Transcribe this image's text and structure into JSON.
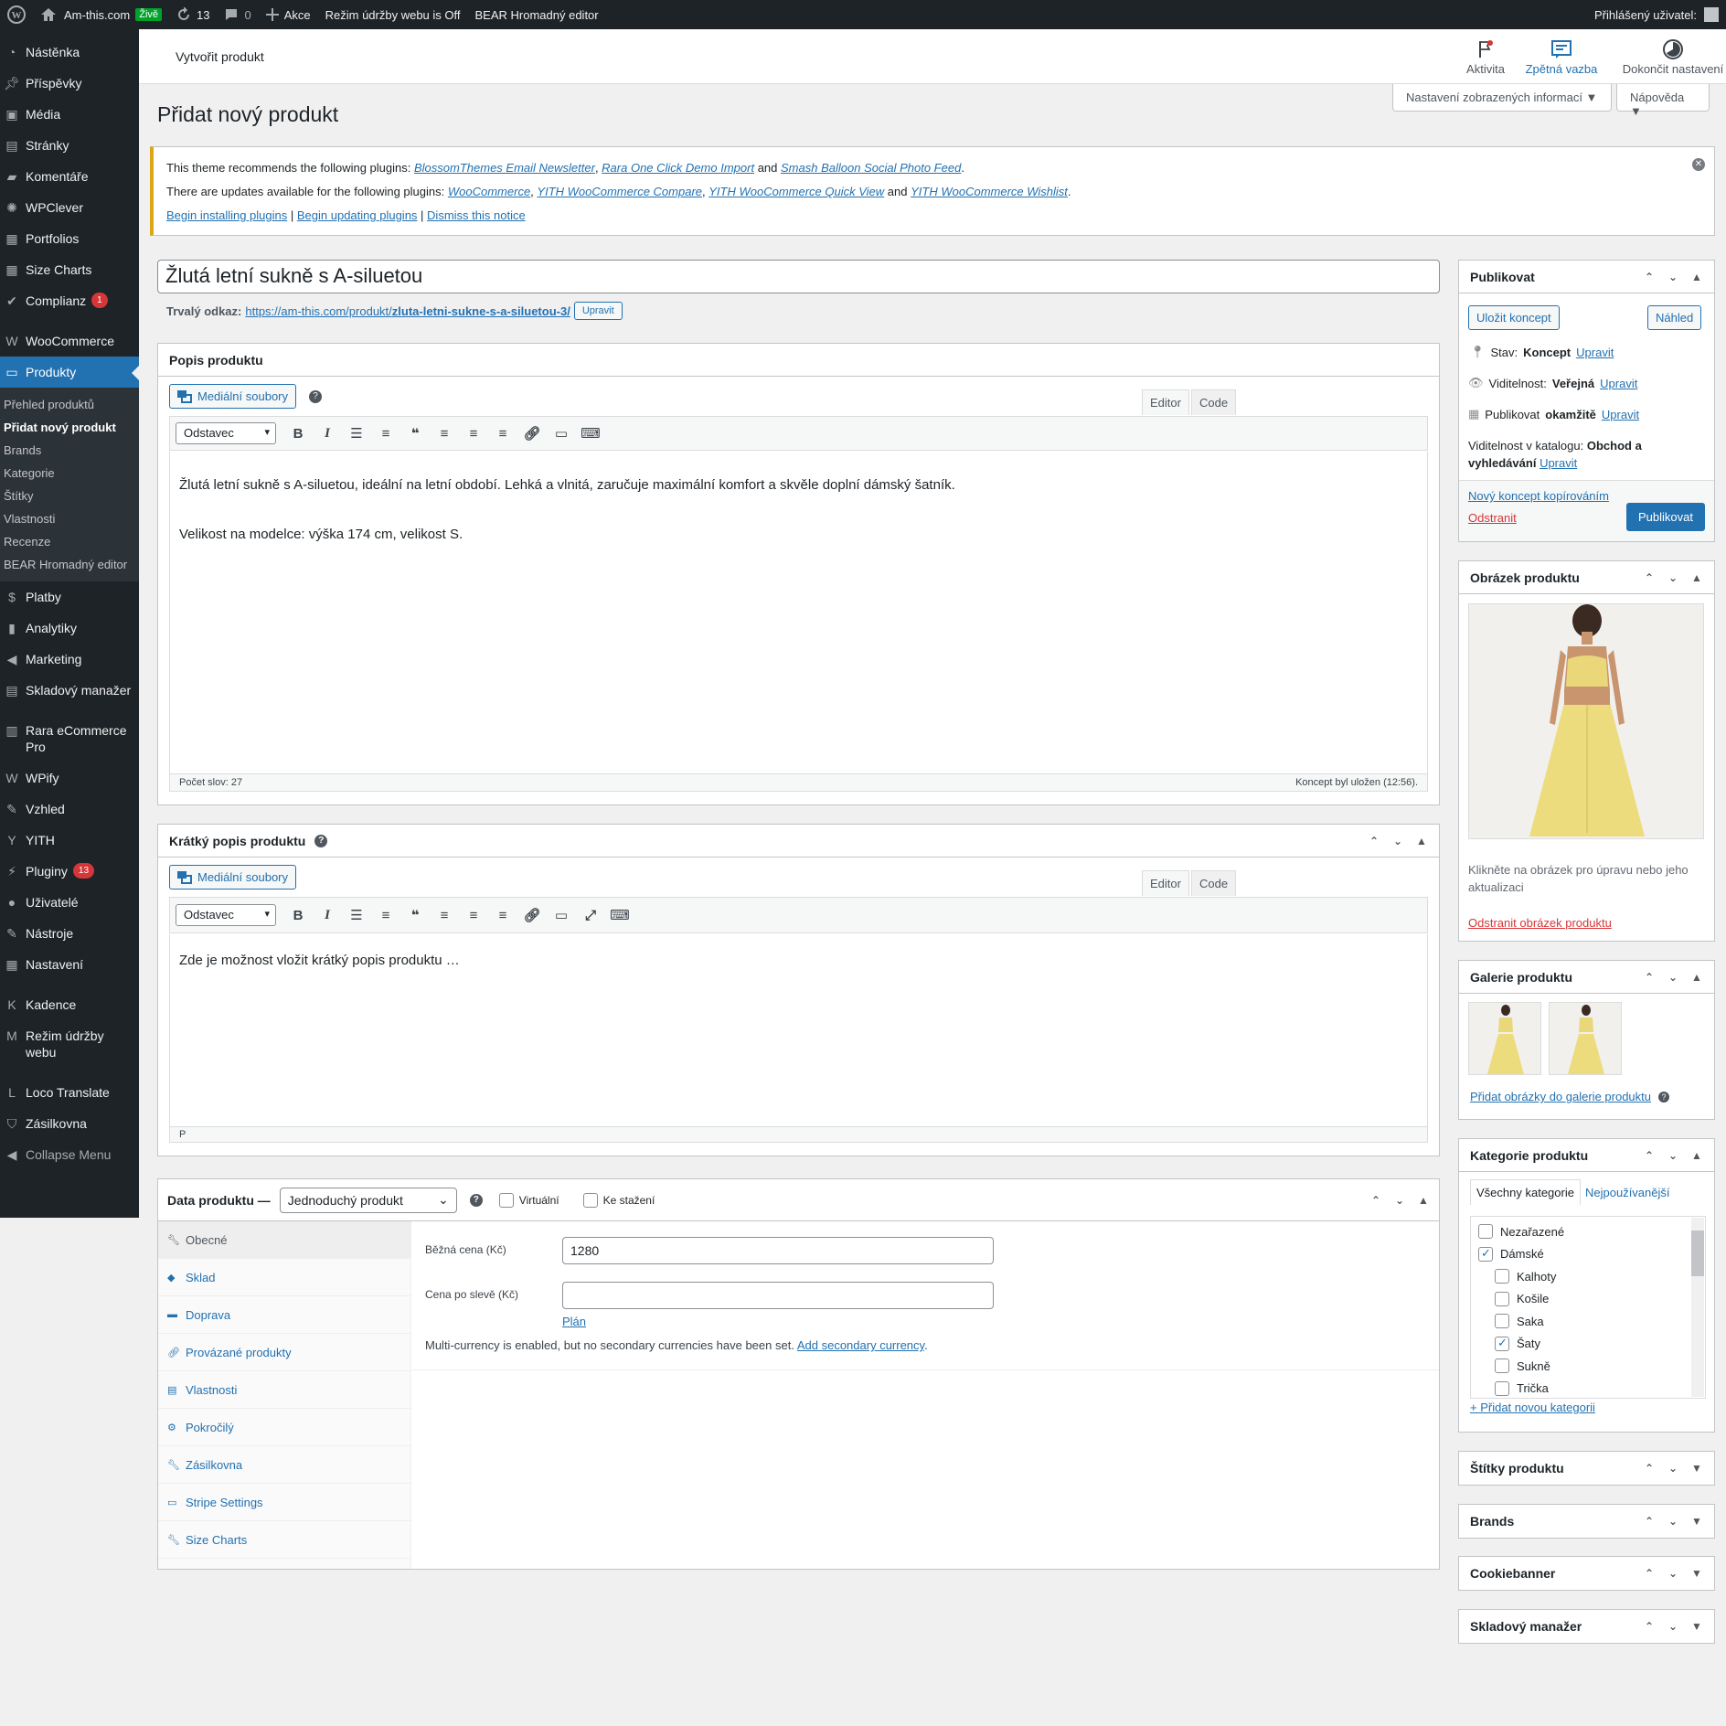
{
  "adminbar": {
    "site_name": "Am-this.com",
    "live_badge": "Živě",
    "updates_count": "13",
    "comments_count": "0",
    "new_label": "Akce",
    "maintenance": "Režim údržby webu is Off",
    "bear": "BEAR Hromadný editor",
    "user_label": "Přihlášený uživatel:"
  },
  "sidebar": {
    "items_top": [
      {
        "label": "Nástěnka",
        "icon": "dashboard-icon"
      },
      {
        "label": "Příspěvky",
        "icon": "pin-icon"
      },
      {
        "label": "Média",
        "icon": "media-icon"
      },
      {
        "label": "Stránky",
        "icon": "pages-icon"
      },
      {
        "label": "Komentáře",
        "icon": "comments-icon"
      },
      {
        "label": "WPClever",
        "icon": "bulb-icon"
      },
      {
        "label": "Portfolios",
        "icon": "portfolio-icon"
      },
      {
        "label": "Size Charts",
        "icon": "table-icon"
      },
      {
        "label": "Complianz",
        "icon": "check-icon",
        "count": "1"
      },
      {
        "label": "WooCommerce",
        "icon": "woo-icon"
      },
      {
        "label": "Produkty",
        "icon": "archive-icon"
      }
    ],
    "submenu": [
      "Přehled produktů",
      "Přidat nový produkt",
      "Brands",
      "Kategorie",
      "Štítky",
      "Vlastnosti",
      "Recenze",
      "BEAR Hromadný editor"
    ],
    "items_bottom": [
      {
        "label": "Platby",
        "icon": "payments-icon"
      },
      {
        "label": "Analytiky",
        "icon": "chart-icon"
      },
      {
        "label": "Marketing",
        "icon": "megaphone-icon"
      },
      {
        "label": "Skladový manažer",
        "icon": "stock-icon"
      },
      {
        "label": "Rara eCommerce Pro",
        "icon": "stats-icon"
      },
      {
        "label": "WPify",
        "icon": "wpify-icon"
      },
      {
        "label": "Vzhled",
        "icon": "brush-icon"
      },
      {
        "label": "YITH",
        "icon": "yith-icon"
      },
      {
        "label": "Pluginy",
        "icon": "plugin-icon",
        "count": "13"
      },
      {
        "label": "Uživatelé",
        "icon": "users-icon"
      },
      {
        "label": "Nástroje",
        "icon": "tools-icon"
      },
      {
        "label": "Nastavení",
        "icon": "settings-icon"
      },
      {
        "label": "Kadence",
        "icon": "kadence-icon"
      },
      {
        "label": "Režim údržby webu",
        "icon": "maintenance-icon"
      },
      {
        "label": "Loco Translate",
        "icon": "translate-icon"
      },
      {
        "label": "Zásilkovna",
        "icon": "shield-icon"
      },
      {
        "label": "Collapse Menu",
        "icon": "collapse-icon"
      }
    ]
  },
  "topbar": {
    "title": "Vytvořit produkt",
    "activity": "Aktivita",
    "feedback": "Zpětná vazba",
    "finish": "Dokončit nastavení",
    "screen_options": "Nastavení zobrazených informací",
    "help": "Nápověda"
  },
  "page_title": "Přidat nový produkt",
  "notice": {
    "line1_prefix": "This theme recommends the following plugins:",
    "line1_plugins": [
      "BlossomThemes Email Newsletter",
      "Rara One Click Demo Import",
      "Smash Balloon Social Photo Feed"
    ],
    "line2_prefix": "There are updates available for the following plugins:",
    "line2_plugins": [
      "WooCommerce",
      "YITH WooCommerce Compare",
      "YITH WooCommerce Quick View",
      "YITH WooCommerce Wishlist"
    ],
    "and": "and",
    "links": [
      "Begin installing plugins",
      "Begin updating plugins",
      "Dismiss this notice"
    ]
  },
  "post_title": "Žlutá letní sukně s A-siluetou",
  "permalink": {
    "label": "Trvalý odkaz:",
    "base": "https://am-this.com/produkt/",
    "slug": "zluta-letni-sukne-s-a-siluetou-3/",
    "edit": "Upravit"
  },
  "description": {
    "title": "Popis produktu",
    "media_button": "Mediální soubory",
    "tab_editor": "Editor",
    "tab_code": "Code",
    "format": "Odstavec",
    "para1": "Žlutá letní sukně s A-siluetou, ideální na letní období. Lehká a vlnitá, zaručuje maximální komfort a skvěle doplní dámský šatník.",
    "para2": "Velikost na modelce: výška 174 cm, velikost S.",
    "word_count": "Počet slov: 27",
    "saved": "Koncept byl uložen (12:56)."
  },
  "short_description": {
    "title": "Krátký popis produktu",
    "media_button": "Mediální soubory",
    "tab_editor": "Editor",
    "tab_code": "Code",
    "format": "Odstavec",
    "placeholder": "Zde je možnost vložit krátký popis produktu …",
    "path": "P"
  },
  "product_data": {
    "title": "Data produktu —",
    "type": "Jednoduchý produkt",
    "virtual": "Virtuální",
    "downloadable": "Ke stažení",
    "tabs": [
      {
        "label": "Obecné",
        "icon": "wrench-icon"
      },
      {
        "label": "Sklad",
        "icon": "tag-icon"
      },
      {
        "label": "Doprava",
        "icon": "truck-icon"
      },
      {
        "label": "Provázané produkty",
        "icon": "link-icon"
      },
      {
        "label": "Vlastnosti",
        "icon": "list-icon"
      },
      {
        "label": "Pokročilý",
        "icon": "gear-icon"
      },
      {
        "label": "Zásilkovna",
        "icon": "wrench-icon"
      },
      {
        "label": "Stripe Settings",
        "icon": "card-icon"
      },
      {
        "label": "Size Charts",
        "icon": "wrench-icon"
      }
    ],
    "regular_price_label": "Běžná cena (Kč)",
    "regular_price": "1280",
    "sale_price_label": "Cena po slevě (Kč)",
    "sale_price": "",
    "schedule": "Plán",
    "currency_note": "Multi-currency is enabled, but no secondary currencies have been set.",
    "currency_link": "Add secondary currency"
  },
  "publish": {
    "title": "Publikovat",
    "save_draft": "Uložit koncept",
    "preview": "Náhled",
    "status_label": "Stav:",
    "status": "Koncept",
    "visibility_label": "Viditelnost:",
    "visibility": "Veřejná",
    "publish_label": "Publikovat",
    "publish_when": "okamžitě",
    "catalog_label": "Viditelnost v katalogu:",
    "catalog": "Obchod a vyhledávání",
    "edit": "Upravit",
    "copy": "Nový koncept kopírováním",
    "trash": "Odstranit",
    "publish_button": "Publikovat"
  },
  "product_image": {
    "title": "Obrázek produktu",
    "hint": "Klikněte na obrázek pro úpravu nebo jeho aktualizaci",
    "remove": "Odstranit obrázek produktu"
  },
  "gallery": {
    "title": "Galerie produktu",
    "add": "Přidat obrázky do galerie produktu"
  },
  "categories": {
    "title": "Kategorie produktu",
    "tab_all": "Všechny kategorie",
    "tab_popular": "Nejpoužívanější",
    "items": [
      {
        "label": "Nezařazené",
        "checked": false,
        "child": false
      },
      {
        "label": "Dámské",
        "checked": true,
        "child": false
      },
      {
        "label": "Kalhoty",
        "checked": false,
        "child": true
      },
      {
        "label": "Košile",
        "checked": false,
        "child": true
      },
      {
        "label": "Saka",
        "checked": false,
        "child": true
      },
      {
        "label": "Šaty",
        "checked": true,
        "child": true
      },
      {
        "label": "Sukně",
        "checked": false,
        "child": true
      },
      {
        "label": "Trička",
        "checked": false,
        "child": true
      }
    ],
    "add": "+ Přidat novou kategorii"
  },
  "collapsed_boxes": [
    "Štítky produktu",
    "Brands",
    "Cookiebanner",
    "Skladový manažer"
  ],
  "colors": {
    "accent": "#2271b1",
    "sidebar": "#1d2327",
    "warning": "#dba617",
    "danger": "#d63638",
    "live": "#00a32a"
  }
}
